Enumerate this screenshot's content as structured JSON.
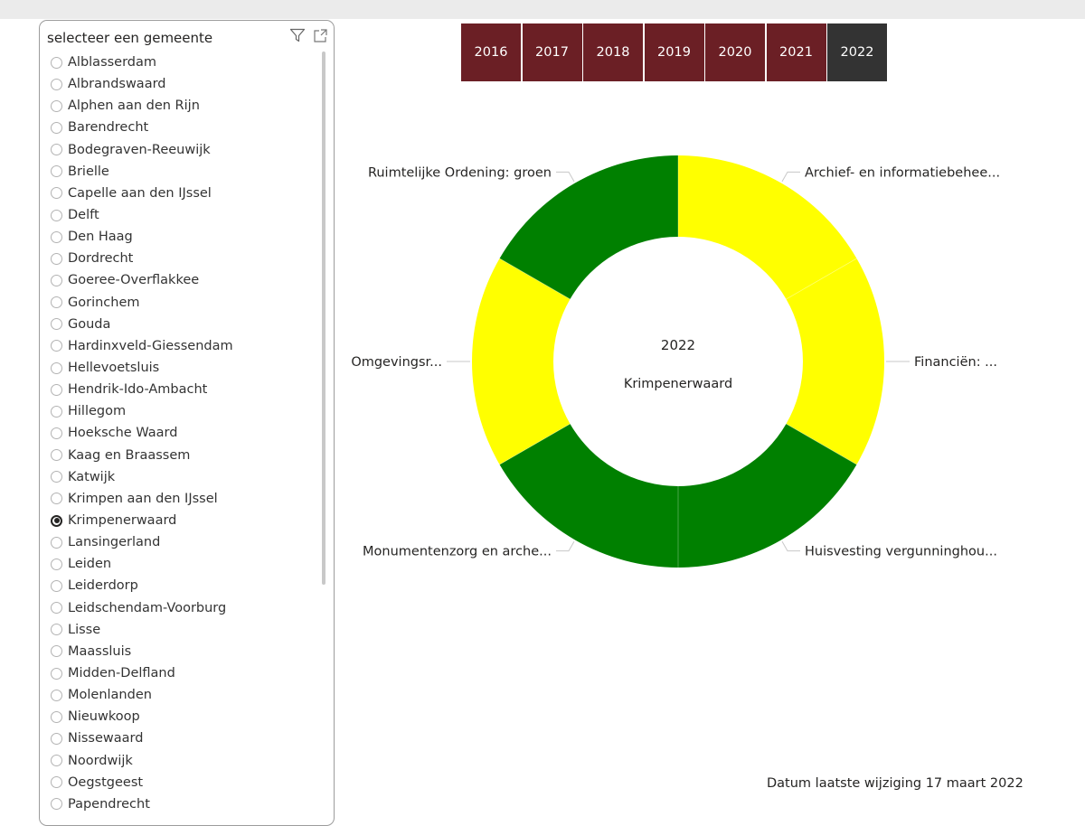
{
  "slicer": {
    "title": "selecteer een gemeente",
    "selected": "Krimpenerwaard",
    "items": [
      "Alblasserdam",
      "Albrandswaard",
      "Alphen aan den Rijn",
      "Barendrecht",
      "Bodegraven-Reeuwijk",
      "Brielle",
      "Capelle aan den IJssel",
      "Delft",
      "Den Haag",
      "Dordrecht",
      "Goeree-Overflakkee",
      "Gorinchem",
      "Gouda",
      "Hardinxveld-Giessendam",
      "Hellevoetsluis",
      "Hendrik-Ido-Ambacht",
      "Hillegom",
      "Hoeksche Waard",
      "Kaag en Braassem",
      "Katwijk",
      "Krimpen aan den IJssel",
      "Krimpenerwaard",
      "Lansingerland",
      "Leiden",
      "Leiderdorp",
      "Leidschendam-Voorburg",
      "Lisse",
      "Maassluis",
      "Midden-Delfland",
      "Molenlanden",
      "Nieuwkoop",
      "Nissewaard",
      "Noordwijk",
      "Oegstgeest",
      "Papendrecht"
    ],
    "icons": [
      "filter-icon",
      "focus-mode-icon"
    ]
  },
  "years": {
    "items": [
      "2016",
      "2017",
      "2018",
      "2019",
      "2020",
      "2021",
      "2022"
    ],
    "selected": "2022",
    "color_default": "#6b1f25",
    "color_selected": "#333333"
  },
  "chart_data": {
    "type": "pie",
    "center_labels": [
      "2022",
      "Krimpenerwaard"
    ],
    "slices": [
      {
        "label": "Archief- en informatiebehee...",
        "value": 1,
        "color": "#ffff00"
      },
      {
        "label": "Financiën: ...",
        "value": 1,
        "color": "#ffff00"
      },
      {
        "label": "Huisvesting vergunninghou...",
        "value": 1,
        "color": "#008000"
      },
      {
        "label": "Monumentenzorg en arche...",
        "value": 1,
        "color": "#008000"
      },
      {
        "label": "Omgevingsr...",
        "value": 1,
        "color": "#ffff00"
      },
      {
        "label": "Ruimtelijke Ordening: groen",
        "value": 1,
        "color": "#008000"
      }
    ]
  },
  "footer": {
    "note": "Datum laatste wijziging 17 maart 2022"
  }
}
